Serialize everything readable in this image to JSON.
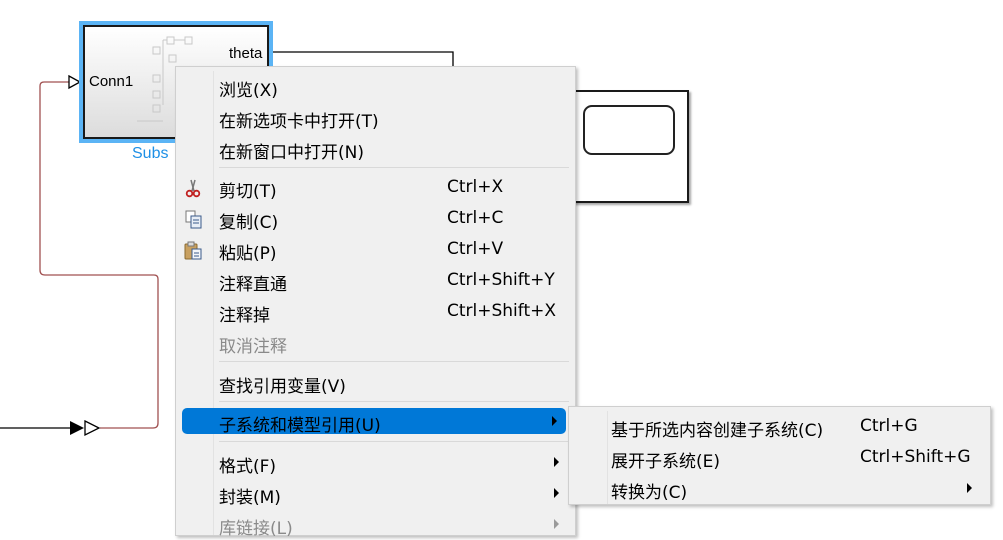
{
  "canvas": {
    "subsystem": {
      "name_visible": "Subs",
      "input_port": "Conn1",
      "output_port": "theta",
      "selection_color": "#5bb4f5"
    },
    "line_color_feedback": "#a05050"
  },
  "context_menu": {
    "items": [
      {
        "label": "浏览(X)",
        "shortcut": "",
        "icon": "",
        "enabled": true
      },
      {
        "label": "在新选项卡中打开(T)",
        "shortcut": "",
        "icon": "",
        "enabled": true
      },
      {
        "label": "在新窗口中打开(N)",
        "shortcut": "",
        "icon": "",
        "enabled": true
      },
      {
        "label": "剪切(T)",
        "shortcut": "Ctrl+X",
        "icon": "scissors-icon",
        "enabled": true
      },
      {
        "label": "复制(C)",
        "shortcut": "Ctrl+C",
        "icon": "copy-icon",
        "enabled": true
      },
      {
        "label": "粘贴(P)",
        "shortcut": "Ctrl+V",
        "icon": "paste-icon",
        "enabled": true
      },
      {
        "label": "注释直通",
        "shortcut": "Ctrl+Shift+Y",
        "icon": "",
        "enabled": true
      },
      {
        "label": "注释掉",
        "shortcut": "Ctrl+Shift+X",
        "icon": "",
        "enabled": true
      },
      {
        "label": "取消注释",
        "shortcut": "",
        "icon": "",
        "enabled": false
      },
      {
        "label": "查找引用变量(V)",
        "shortcut": "",
        "icon": "",
        "enabled": true
      },
      {
        "label": "子系统和模型引用(U)",
        "shortcut": "",
        "submenu": true,
        "highlighted": true,
        "enabled": true
      },
      {
        "label": "格式(F)",
        "shortcut": "",
        "submenu": true,
        "enabled": true
      },
      {
        "label": "封装(M)",
        "shortcut": "",
        "submenu": true,
        "enabled": true
      },
      {
        "label": "库链接(L)",
        "shortcut": "",
        "submenu": true,
        "enabled": false
      }
    ],
    "highlight_color": "#0078d7"
  },
  "submenu": {
    "items": [
      {
        "label": "基于所选内容创建子系统(C)",
        "shortcut": "Ctrl+G"
      },
      {
        "label": "展开子系统(E)",
        "shortcut": "Ctrl+Shift+G"
      },
      {
        "label": "转换为(C)",
        "shortcut": "",
        "submenu": true
      }
    ]
  }
}
